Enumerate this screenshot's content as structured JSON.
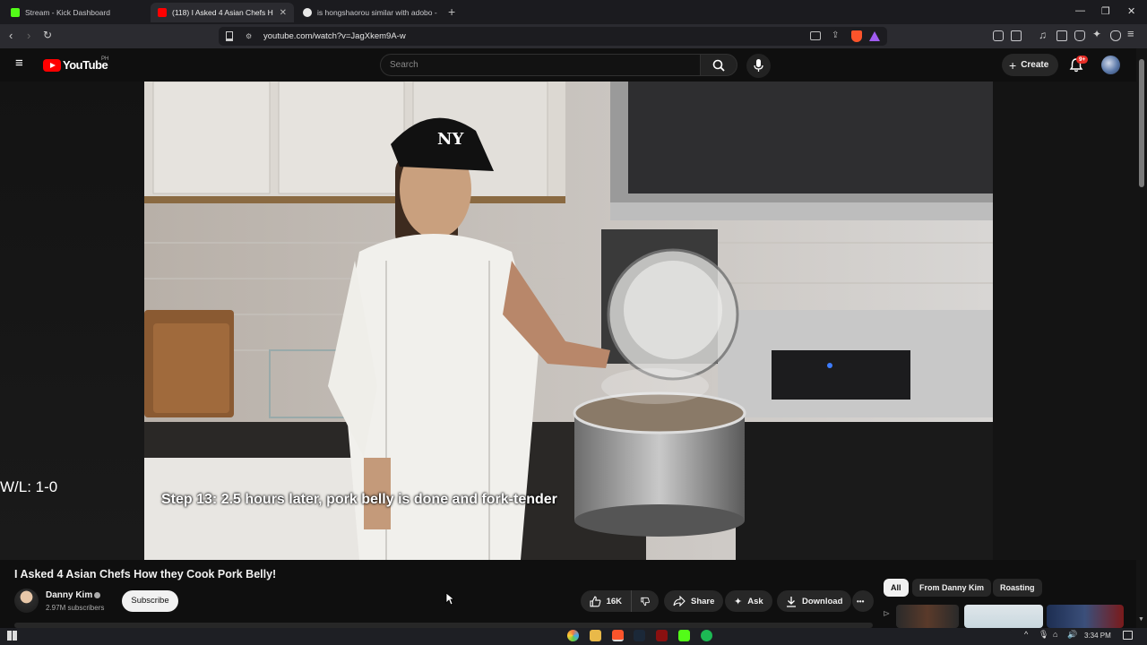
{
  "browser": {
    "tabs": [
      {
        "title": "Stream - Kick Dashboard",
        "favicon_color": "#53fc18",
        "active": false
      },
      {
        "title": "(118) I Asked 4 Asian Chefs H",
        "favicon_color": "#ff0000",
        "active": true
      },
      {
        "title": "is hongshaorou similar with adobo -",
        "favicon_color": "#e8e8e8",
        "active": false
      }
    ],
    "new_tab_label": "+",
    "url": "youtube.com/watch?v=JagXkem9A-w",
    "window_controls": [
      "—",
      "❐",
      "✕"
    ]
  },
  "youtube": {
    "logo_text": "YouTube",
    "country_code": "PH",
    "search_placeholder": "Search",
    "create_label": "Create",
    "notification_count": "9+"
  },
  "video": {
    "overlay_text": "W/L: 1-0",
    "caption": "Step 13: 2.5 hours later, pork belly is done and fork-tender",
    "title": "I Asked 4 Asian Chefs How they Cook Pork Belly!",
    "channel": {
      "name": "Danny Kim",
      "subscribers": "2.97M subscribers",
      "subscribe_label": "Subscribe"
    },
    "actions": {
      "likes": "16K",
      "share": "Share",
      "ask": "Ask",
      "download": "Download",
      "more": "•••"
    }
  },
  "recommendations": {
    "chips": [
      "All",
      "From Danny Kim",
      "Roasting"
    ],
    "selected_chip": "All"
  },
  "taskbar": {
    "time": "3:34 PM"
  },
  "colors": {
    "youtube_red": "#ff0000",
    "background": "#0f0f0f",
    "pill": "#272727"
  }
}
